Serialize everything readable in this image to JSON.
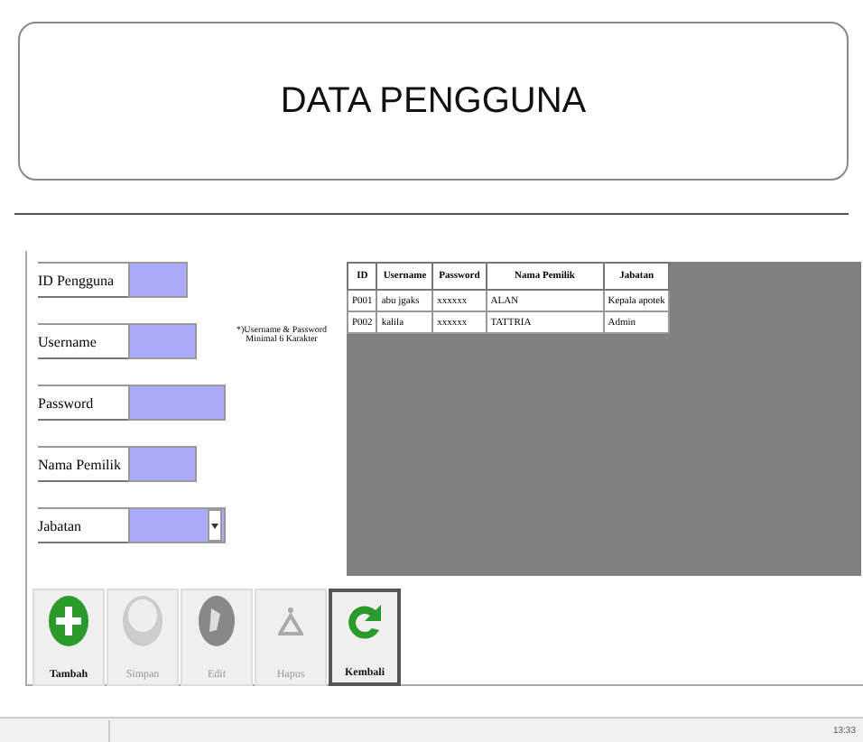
{
  "title": "DATA PENGGUNA",
  "form": {
    "fields": [
      {
        "label": "ID Pengguna",
        "kind": "text"
      },
      {
        "label": "Username",
        "kind": "text"
      },
      {
        "label": "Password",
        "kind": "text"
      },
      {
        "label": "Nama Pemilik",
        "kind": "text"
      },
      {
        "label": "Jabatan",
        "kind": "select"
      }
    ],
    "note": "*)Username & Password Minimal 6 Karakter"
  },
  "table": {
    "columns": [
      "ID",
      "Username",
      "Password",
      "Nama Pemilik",
      "Jabatan"
    ],
    "rows": [
      [
        "P001",
        "abu jgaks",
        "xxxxxx",
        "ALAN",
        "Kepala apotek"
      ],
      [
        "P002",
        "kalila",
        "xxxxxx",
        "TATTRIA",
        "Admin"
      ]
    ]
  },
  "buttons": [
    {
      "label": "Tambah",
      "disabled": false,
      "selected": false
    },
    {
      "label": "Simpan",
      "disabled": true,
      "selected": false
    },
    {
      "label": "Edit",
      "disabled": true,
      "selected": false
    },
    {
      "label": "Hapus",
      "disabled": true,
      "selected": false
    },
    {
      "label": "Kembali",
      "disabled": false,
      "selected": true
    }
  ],
  "status_bar": {
    "clock": "13:33"
  }
}
